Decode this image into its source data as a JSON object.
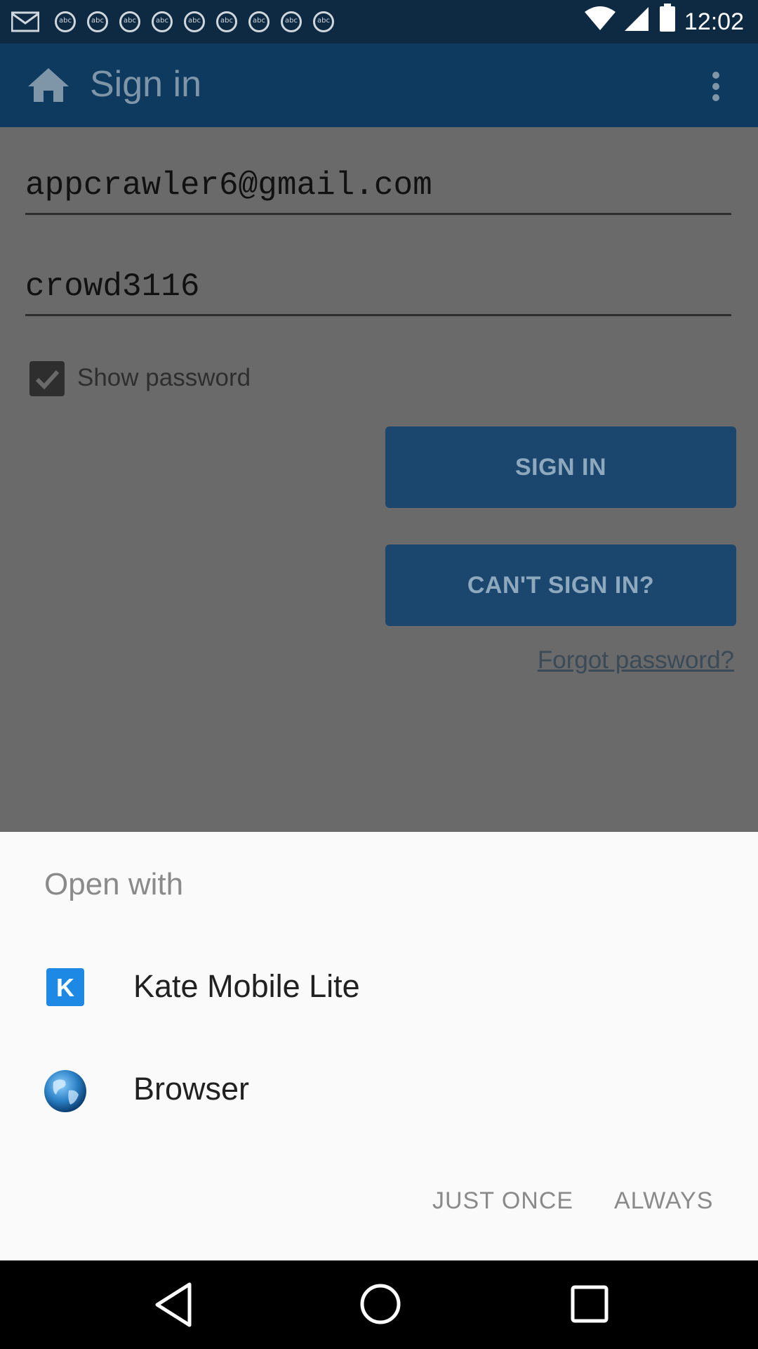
{
  "status_bar": {
    "time": "12:02",
    "notification_icons": [
      "mail-icon",
      "news-icon",
      "news-icon",
      "news-icon",
      "news-icon",
      "news-icon",
      "news-icon",
      "news-icon",
      "news-icon"
    ],
    "news_badge": "abc"
  },
  "app": {
    "title": "Sign in",
    "email_value": "appcrawler6@gmail.com",
    "password_value": "crowd3116",
    "show_password_label": "Show password",
    "show_password_checked": true,
    "sign_in_button": "SIGN IN",
    "cant_sign_in_button": "CAN'T SIGN IN?",
    "forgot_password_link": "Forgot password?",
    "colors": {
      "appbar": "#0f3a5f",
      "button": "#1b466d",
      "scrim_background": "#6a6a6a"
    }
  },
  "dialog": {
    "title": "Open with",
    "apps": [
      {
        "label": "Kate Mobile Lite",
        "icon": "kate-mobile-icon"
      },
      {
        "label": "Browser",
        "icon": "globe-icon"
      }
    ],
    "just_once": "JUST ONCE",
    "always": "ALWAYS"
  },
  "nav_bar": {
    "buttons": [
      "back-icon",
      "home-icon",
      "recents-icon"
    ]
  }
}
